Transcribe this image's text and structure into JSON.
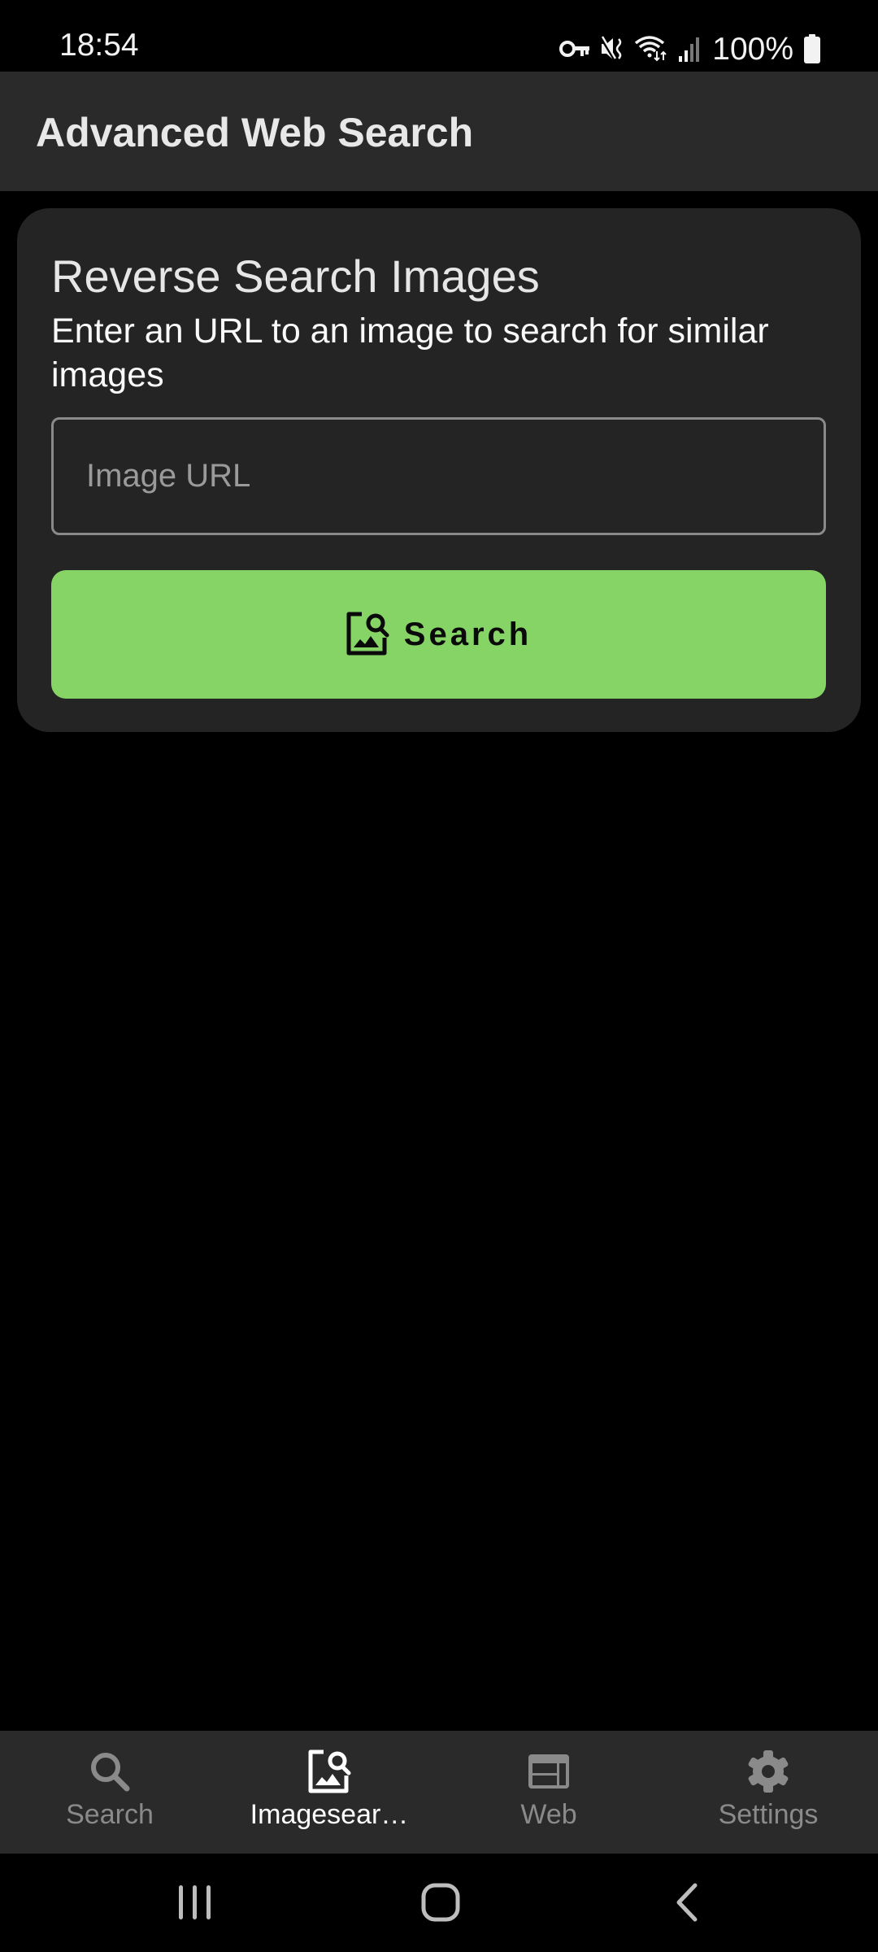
{
  "status_bar": {
    "time": "18:54",
    "icons": [
      "vpn-key-icon",
      "mute-icon",
      "wifi-icon",
      "signal-icon",
      "battery-icon"
    ],
    "battery_text": "100%"
  },
  "app_bar": {
    "title": "Advanced Web Search"
  },
  "card": {
    "title": "Reverse Search Images",
    "subtitle": "Enter an URL to an image to search for similar images",
    "input": {
      "value": "",
      "placeholder": "Image URL"
    },
    "button": {
      "label": "Search",
      "icon": "image-search-icon",
      "color": "#86d466"
    }
  },
  "bottom_nav": {
    "active_index": 1,
    "items": [
      {
        "label": "Search",
        "icon": "search-icon"
      },
      {
        "label": "Imagesear…",
        "icon": "image-search-icon"
      },
      {
        "label": "Web",
        "icon": "web-icon"
      },
      {
        "label": "Settings",
        "icon": "settings-gear-icon"
      }
    ]
  },
  "system_nav": {
    "buttons": [
      "recent-apps",
      "home",
      "back"
    ]
  },
  "colors": {
    "background": "#000000",
    "app_bar": "#2a2a2a",
    "card": "#242424",
    "accent": "#86d466",
    "inactive": "#8a8a8a"
  }
}
